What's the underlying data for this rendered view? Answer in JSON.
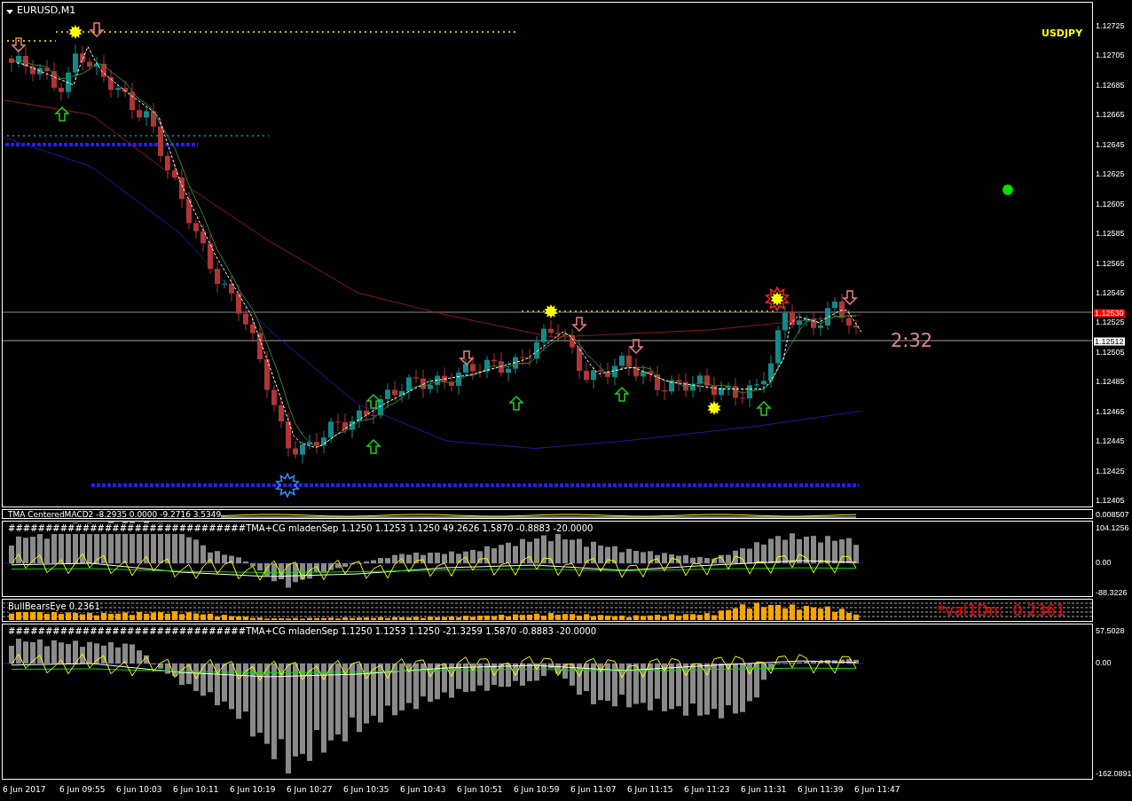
{
  "chart": {
    "title": "EURUSD,M1",
    "symbol_label": "USDJPY",
    "timer": "2:32",
    "price_axis": [
      "1.12725",
      "1.12705",
      "1.12685",
      "1.12665",
      "1.12645",
      "1.12625",
      "1.12605",
      "1.12585",
      "1.12565",
      "1.12545",
      "1.12525",
      "1.12505",
      "1.12485",
      "1.12465",
      "1.12445",
      "1.12425",
      "1.12405"
    ],
    "price_markers": [
      {
        "text": "1.12530",
        "kind": "bid"
      },
      {
        "text": "1.12512",
        "kind": "last"
      }
    ]
  },
  "indicators": [
    {
      "kind": "strip",
      "header": "TMA CenteredMACD2 -8.2935 0.0000 -9.2716 3.5349",
      "axis": [
        "0.008507"
      ]
    },
    {
      "kind": "histogram",
      "header": "################################TMA+CG mladenSep 1.1250 1.1253 1.1250 49.2626 1.5870 -0.8883 -20.0000",
      "axis": [
        "104.1256",
        "0.00",
        "-88.3226"
      ]
    },
    {
      "kind": "bars",
      "header": "BullBearsEye 0.2361",
      "overlay": "*val1Dn:  0.2361"
    },
    {
      "kind": "histogram",
      "header": "################################TMA+CG mladenSep 1.1250 1.1253 1.1250 -21.3259 1.5870 -0.8883 -20.0000",
      "axis": [
        "57.5028",
        "0.00",
        "-162.0891"
      ]
    }
  ],
  "time_axis": [
    "6 Jun 2017",
    "6 Jun 09:55",
    "6 Jun 10:03",
    "6 Jun 10:11",
    "6 Jun 10:19",
    "6 Jun 10:27",
    "6 Jun 10:35",
    "6 Jun 10:43",
    "6 Jun 10:51",
    "6 Jun 10:59",
    "6 Jun 11:07",
    "6 Jun 11:15",
    "6 Jun 11:23",
    "6 Jun 11:31",
    "6 Jun 11:39",
    "6 Jun 11:47"
  ]
}
